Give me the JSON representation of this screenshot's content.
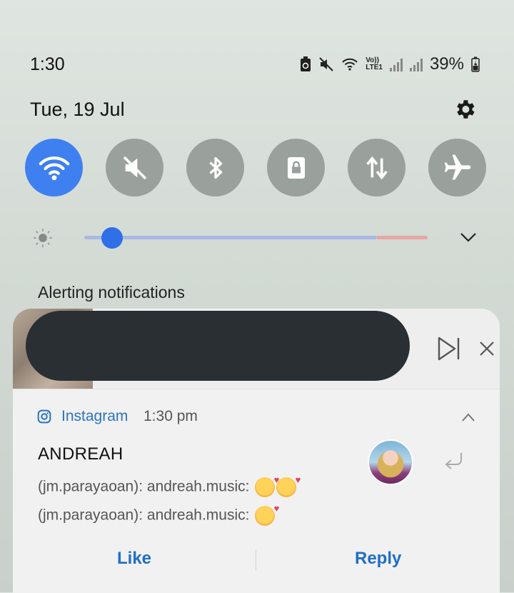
{
  "status_bar": {
    "time": "1:30",
    "network_label_top": "Vo))",
    "network_label_bottom": "LTE1",
    "battery_percent": "39%"
  },
  "shade": {
    "date": "Tue, 19 Jul"
  },
  "quick_settings": [
    {
      "name": "wifi",
      "icon": "wifi-icon",
      "active": true
    },
    {
      "name": "sound",
      "icon": "mute-icon",
      "active": false
    },
    {
      "name": "bluetooth",
      "icon": "bluetooth-icon",
      "active": false
    },
    {
      "name": "portrait-lock",
      "icon": "lock-icon",
      "active": false
    },
    {
      "name": "mobile-data",
      "icon": "data-arrows-icon",
      "active": false
    },
    {
      "name": "airplane",
      "icon": "airplane-icon",
      "active": false
    }
  ],
  "brightness": {
    "level": 0.06
  },
  "notifications": {
    "section_label": "Alerting notifications",
    "media": {
      "title_redacted": true
    },
    "instagram": {
      "app_name": "Instagram",
      "time": "1:30 pm",
      "sender": "ANDREAH",
      "messages": [
        "(jm.parayaoan): andreah.music:",
        "(jm.parayaoan): andreah.music:"
      ],
      "actions": {
        "like": "Like",
        "reply": "Reply"
      }
    }
  },
  "colors": {
    "accent": "#3f80f0",
    "link": "#1f6fc4",
    "tile_inactive": "#9aa09c"
  }
}
